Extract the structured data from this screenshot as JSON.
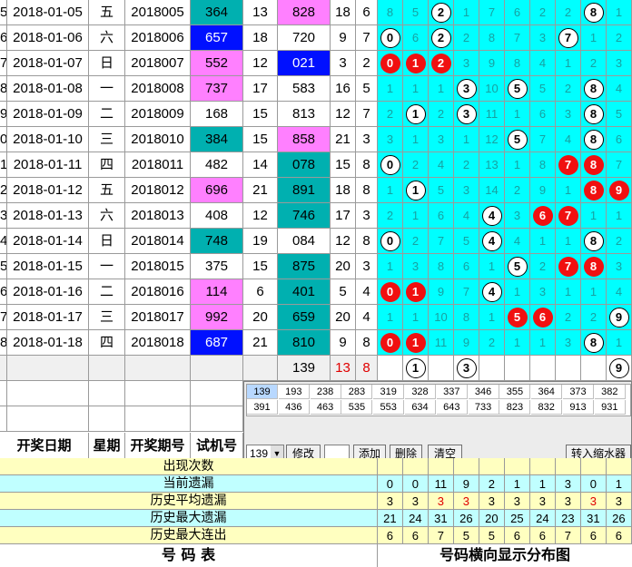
{
  "rows": [
    {
      "n": "5",
      "date": "2018-01-05",
      "wd": "五",
      "issue": "2018005",
      "test": "364",
      "testc": "teal",
      "a": "13",
      "win": "828",
      "winc": "pink",
      "b": "18",
      "c": "6",
      "dist": [
        [
          "8",
          ""
        ],
        [
          "5",
          ""
        ],
        [
          "2",
          "w"
        ],
        [
          "1",
          ""
        ],
        [
          "7",
          ""
        ],
        [
          "6",
          ""
        ],
        [
          "2",
          ""
        ],
        [
          "2",
          ""
        ],
        [
          "8",
          "w"
        ],
        [
          "1",
          ""
        ]
      ]
    },
    {
      "n": "6",
      "date": "2018-01-06",
      "wd": "六",
      "issue": "2018006",
      "test": "657",
      "testc": "blue",
      "a": "18",
      "win": "720",
      "winc": "",
      "b": "9",
      "c": "7",
      "dist": [
        [
          "0",
          "w"
        ],
        [
          "6",
          ""
        ],
        [
          "2",
          "w"
        ],
        [
          "2",
          ""
        ],
        [
          "8",
          ""
        ],
        [
          "7",
          ""
        ],
        [
          "3",
          ""
        ],
        [
          "7",
          "w"
        ],
        [
          "1",
          ""
        ],
        [
          "2",
          ""
        ]
      ]
    },
    {
      "n": "7",
      "date": "2018-01-07",
      "wd": "日",
      "issue": "2018007",
      "test": "552",
      "testc": "pink",
      "a": "12",
      "win": "021",
      "winc": "blue",
      "b": "3",
      "c": "2",
      "dist": [
        [
          "0",
          "r"
        ],
        [
          "1",
          "r"
        ],
        [
          "2",
          "r"
        ],
        [
          "3",
          ""
        ],
        [
          "9",
          ""
        ],
        [
          "8",
          ""
        ],
        [
          "4",
          ""
        ],
        [
          "1",
          ""
        ],
        [
          "2",
          ""
        ],
        [
          "3",
          ""
        ]
      ]
    },
    {
      "n": "8",
      "date": "2018-01-08",
      "wd": "一",
      "issue": "2018008",
      "test": "737",
      "testc": "pink",
      "a": "17",
      "win": "583",
      "winc": "",
      "b": "16",
      "c": "5",
      "dist": [
        [
          "1",
          ""
        ],
        [
          "1",
          ""
        ],
        [
          "1",
          ""
        ],
        [
          "3",
          "w"
        ],
        [
          "10",
          ""
        ],
        [
          "5",
          "w"
        ],
        [
          "5",
          ""
        ],
        [
          "2",
          ""
        ],
        [
          "8",
          "w"
        ],
        [
          "4",
          ""
        ]
      ]
    },
    {
      "n": "9",
      "date": "2018-01-09",
      "wd": "二",
      "issue": "2018009",
      "test": "168",
      "testc": "",
      "a": "15",
      "win": "813",
      "winc": "",
      "b": "12",
      "c": "7",
      "dist": [
        [
          "2",
          ""
        ],
        [
          "1",
          "w"
        ],
        [
          "2",
          ""
        ],
        [
          "3",
          "w"
        ],
        [
          "11",
          ""
        ],
        [
          "1",
          ""
        ],
        [
          "6",
          ""
        ],
        [
          "3",
          ""
        ],
        [
          "8",
          "w"
        ],
        [
          "5",
          ""
        ]
      ]
    },
    {
      "n": "0",
      "date": "2018-01-10",
      "wd": "三",
      "issue": "2018010",
      "test": "384",
      "testc": "teal",
      "a": "15",
      "win": "858",
      "winc": "pink",
      "b": "21",
      "c": "3",
      "dist": [
        [
          "3",
          ""
        ],
        [
          "1",
          ""
        ],
        [
          "3",
          ""
        ],
        [
          "1",
          ""
        ],
        [
          "12",
          ""
        ],
        [
          "5",
          "w"
        ],
        [
          "7",
          ""
        ],
        [
          "4",
          ""
        ],
        [
          "8",
          "w"
        ],
        [
          "6",
          ""
        ]
      ]
    },
    {
      "n": "1",
      "date": "2018-01-11",
      "wd": "四",
      "issue": "2018011",
      "test": "482",
      "testc": "",
      "a": "14",
      "win": "078",
      "winc": "teal",
      "b": "15",
      "c": "8",
      "dist": [
        [
          "0",
          "w"
        ],
        [
          "2",
          ""
        ],
        [
          "4",
          ""
        ],
        [
          "2",
          ""
        ],
        [
          "13",
          ""
        ],
        [
          "1",
          ""
        ],
        [
          "8",
          ""
        ],
        [
          "7",
          "r"
        ],
        [
          "8",
          "r"
        ],
        [
          "7",
          ""
        ]
      ]
    },
    {
      "n": "2",
      "date": "2018-01-12",
      "wd": "五",
      "issue": "2018012",
      "test": "696",
      "testc": "pink",
      "a": "21",
      "win": "891",
      "winc": "teal",
      "b": "18",
      "c": "8",
      "dist": [
        [
          "1",
          ""
        ],
        [
          "1",
          "w"
        ],
        [
          "5",
          ""
        ],
        [
          "3",
          ""
        ],
        [
          "14",
          ""
        ],
        [
          "2",
          ""
        ],
        [
          "9",
          ""
        ],
        [
          "1",
          ""
        ],
        [
          "8",
          "r"
        ],
        [
          "9",
          "r"
        ]
      ]
    },
    {
      "n": "3",
      "date": "2018-01-13",
      "wd": "六",
      "issue": "2018013",
      "test": "408",
      "testc": "",
      "a": "12",
      "win": "746",
      "winc": "teal",
      "b": "17",
      "c": "3",
      "dist": [
        [
          "2",
          ""
        ],
        [
          "1",
          ""
        ],
        [
          "6",
          ""
        ],
        [
          "4",
          ""
        ],
        [
          "4",
          "w"
        ],
        [
          "3",
          ""
        ],
        [
          "6",
          "r"
        ],
        [
          "7",
          "r"
        ],
        [
          "1",
          ""
        ],
        [
          "1",
          ""
        ]
      ]
    },
    {
      "n": "4",
      "date": "2018-01-14",
      "wd": "日",
      "issue": "2018014",
      "test": "748",
      "testc": "teal",
      "a": "19",
      "win": "084",
      "winc": "",
      "b": "12",
      "c": "8",
      "dist": [
        [
          "0",
          "w"
        ],
        [
          "2",
          ""
        ],
        [
          "7",
          ""
        ],
        [
          "5",
          ""
        ],
        [
          "4",
          "w"
        ],
        [
          "4",
          ""
        ],
        [
          "1",
          ""
        ],
        [
          "1",
          ""
        ],
        [
          "8",
          "w"
        ],
        [
          "2",
          ""
        ]
      ]
    },
    {
      "n": "5",
      "date": "2018-01-15",
      "wd": "一",
      "issue": "2018015",
      "test": "375",
      "testc": "",
      "a": "15",
      "win": "875",
      "winc": "teal",
      "b": "20",
      "c": "3",
      "dist": [
        [
          "1",
          ""
        ],
        [
          "3",
          ""
        ],
        [
          "8",
          ""
        ],
        [
          "6",
          ""
        ],
        [
          "1",
          ""
        ],
        [
          "5",
          "w"
        ],
        [
          "2",
          ""
        ],
        [
          "7",
          "r"
        ],
        [
          "8",
          "r"
        ],
        [
          "3",
          ""
        ]
      ]
    },
    {
      "n": "6",
      "date": "2018-01-16",
      "wd": "二",
      "issue": "2018016",
      "test": "114",
      "testc": "pink",
      "a": "6",
      "win": "401",
      "winc": "teal",
      "b": "5",
      "c": "4",
      "dist": [
        [
          "0",
          "r"
        ],
        [
          "1",
          "r"
        ],
        [
          "9",
          ""
        ],
        [
          "7",
          ""
        ],
        [
          "4",
          "w"
        ],
        [
          "1",
          ""
        ],
        [
          "3",
          ""
        ],
        [
          "1",
          ""
        ],
        [
          "1",
          ""
        ],
        [
          "4",
          ""
        ]
      ]
    },
    {
      "n": "7",
      "date": "2018-01-17",
      "wd": "三",
      "issue": "2018017",
      "test": "992",
      "testc": "pink",
      "a": "20",
      "win": "659",
      "winc": "teal",
      "b": "20",
      "c": "4",
      "dist": [
        [
          "1",
          ""
        ],
        [
          "1",
          ""
        ],
        [
          "10",
          ""
        ],
        [
          "8",
          ""
        ],
        [
          "1",
          ""
        ],
        [
          "5",
          "r"
        ],
        [
          "6",
          "r"
        ],
        [
          "2",
          ""
        ],
        [
          "2",
          ""
        ],
        [
          "9",
          "w"
        ]
      ]
    },
    {
      "n": "8",
      "date": "2018-01-18",
      "wd": "四",
      "issue": "2018018",
      "test": "687",
      "testc": "blue",
      "a": "21",
      "win": "810",
      "winc": "teal",
      "b": "9",
      "c": "8",
      "dist": [
        [
          "0",
          "r"
        ],
        [
          "1",
          "r"
        ],
        [
          "11",
          ""
        ],
        [
          "9",
          ""
        ],
        [
          "2",
          ""
        ],
        [
          "1",
          ""
        ],
        [
          "1",
          ""
        ],
        [
          "3",
          ""
        ],
        [
          "8",
          "w"
        ],
        [
          "1",
          ""
        ]
      ]
    }
  ],
  "pending": {
    "win": "139",
    "b": "13",
    "c": "8",
    "dist": [
      [
        "",
        ""
      ],
      [
        "1",
        "w"
      ],
      [
        "",
        ""
      ],
      [
        "3",
        "w"
      ],
      [
        "",
        ""
      ],
      [
        "",
        ""
      ],
      [
        "",
        ""
      ],
      [
        "",
        ""
      ],
      [
        "",
        ""
      ],
      [
        "9",
        "w"
      ]
    ]
  },
  "panel": {
    "row1": [
      "139",
      "193",
      "238",
      "283",
      "319",
      "328",
      "337",
      "346",
      "355",
      "364",
      "373",
      "382"
    ],
    "row2": [
      "391",
      "436",
      "463",
      "535",
      "553",
      "634",
      "643",
      "733",
      "823",
      "832",
      "913",
      "931"
    ],
    "select_value": "139",
    "modify": "修改",
    "add": "添加",
    "delete": "删除",
    "clear": "清空",
    "zoom": "转入缩水器"
  },
  "headers": {
    "date": "开奖日期",
    "weekday": "星期",
    "issue": "开奖期号",
    "test": "试机号"
  },
  "stats": [
    {
      "label": "出现次数",
      "values": [
        "",
        "",
        "",
        "",
        "",
        "",
        "",
        "",
        "",
        ""
      ]
    },
    {
      "label": "当前遗漏",
      "values": [
        "0",
        "0",
        "11",
        "9",
        "2",
        "1",
        "1",
        "3",
        "0",
        "1"
      ],
      "reds": []
    },
    {
      "label": "历史平均遗漏",
      "values": [
        "3",
        "3",
        "3",
        "3",
        "3",
        "3",
        "3",
        "3",
        "3",
        "3"
      ],
      "reds": [
        2,
        3,
        8
      ]
    },
    {
      "label": "历史最大遗漏",
      "values": [
        "21",
        "24",
        "31",
        "26",
        "20",
        "25",
        "24",
        "23",
        "31",
        "26"
      ],
      "reds": []
    },
    {
      "label": "历史最大连出",
      "values": [
        "6",
        "6",
        "7",
        "5",
        "5",
        "6",
        "6",
        "7",
        "6",
        "6"
      ],
      "reds": []
    }
  ],
  "footer": {
    "left": "号 码 表",
    "right": "号码横向显示分布图"
  },
  "colors": {
    "cyan": "#00ffff",
    "pink": "#ff80ff",
    "teal": "#00b0b0",
    "blue": "#0010ff",
    "yellowrow": "#ffffc0",
    "cyanrow": "#c0ffff"
  }
}
